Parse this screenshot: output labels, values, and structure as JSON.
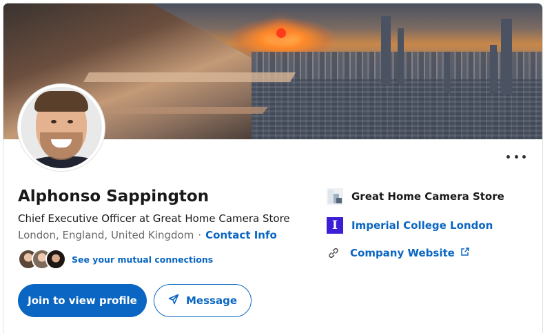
{
  "profile": {
    "name": "Alphonso Sappington",
    "headline": "Chief Executive Officer at Great Home Camera Store",
    "location": "London, England, United Kingdom",
    "separator": "·",
    "contact_info_label": "Contact Info",
    "mutual_connections_label": "See your mutual connections"
  },
  "actions": {
    "join_label": "Join to view profile",
    "message_label": "Message"
  },
  "sidebar": {
    "company": "Great Home Camera Store",
    "school": "Imperial College London",
    "school_logo_letter": "I",
    "website_label": "Company Website"
  },
  "icons": {
    "more": "more-horizontal-icon",
    "message": "send-icon",
    "website": "link-icon",
    "external": "external-link-icon"
  },
  "colors": {
    "accent": "#0a66c2",
    "school_logo_bg": "#3b1fd6"
  }
}
